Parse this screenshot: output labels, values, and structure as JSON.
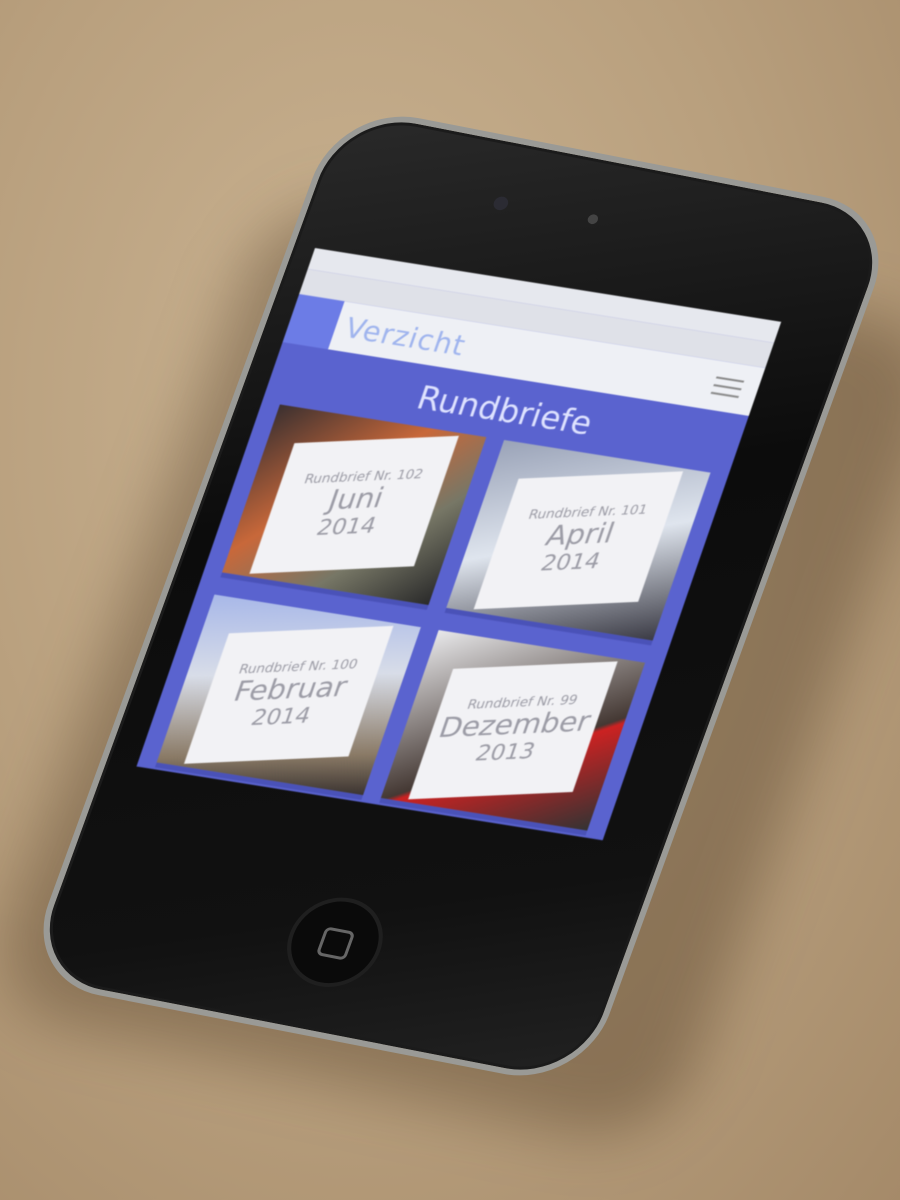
{
  "header": {
    "brand": "Verzicht"
  },
  "page": {
    "title": "Rundbriefe"
  },
  "newsletters": [
    {
      "number": "Rundbrief Nr. 102",
      "month": "Juni",
      "year": "2014"
    },
    {
      "number": "Rundbrief Nr. 101",
      "month": "April",
      "year": "2014"
    },
    {
      "number": "Rundbrief Nr. 100",
      "month": "Februar",
      "year": "2014"
    },
    {
      "number": "Rundbrief Nr. 99",
      "month": "Dezember",
      "year": "2013"
    }
  ],
  "colors": {
    "accent": "#5a63cf",
    "header_bg": "#eef0f5",
    "card_label": "#f2f2f5"
  }
}
